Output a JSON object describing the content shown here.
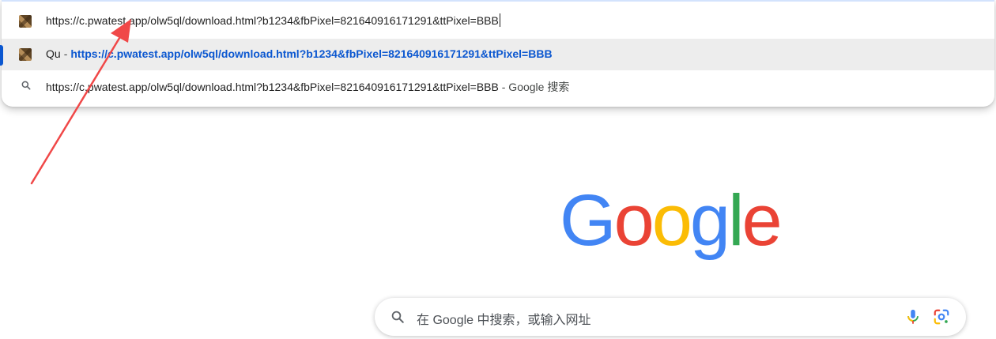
{
  "omnibox": {
    "input_value": "https://c.pwatest.app/olw5ql/download.html?b1234&fbPixel=821640916171291&ttPixel=BBB",
    "favicon_icon": "site-favicon",
    "suggestions": [
      {
        "title": "Qu",
        "separator": "-",
        "url": "https://c.pwatest.app/olw5ql/download.html?b1234&fbPixel=821640916171291&ttPixel=BBB",
        "icon": "site-favicon",
        "selected": true
      },
      {
        "url": "https://c.pwatest.app/olw5ql/download.html?b1234&fbPixel=821640916171291&ttPixel=BBB",
        "suffix": " - Google 搜索",
        "icon": "search-icon"
      }
    ]
  },
  "logo": {
    "text": "Google",
    "letter_colors": [
      "#4285F4",
      "#EA4335",
      "#FBBC05",
      "#4285F4",
      "#34A853",
      "#EA4335"
    ]
  },
  "search": {
    "placeholder": "在 Google 中搜索，或输入网址",
    "icons": [
      "search-icon",
      "mic-icon",
      "lens-icon"
    ]
  },
  "annotation": {
    "type": "red-arrow",
    "color": "#f04848"
  },
  "colors": {
    "accent": "#0b57d0",
    "selected_row_bg": "#ededed"
  }
}
